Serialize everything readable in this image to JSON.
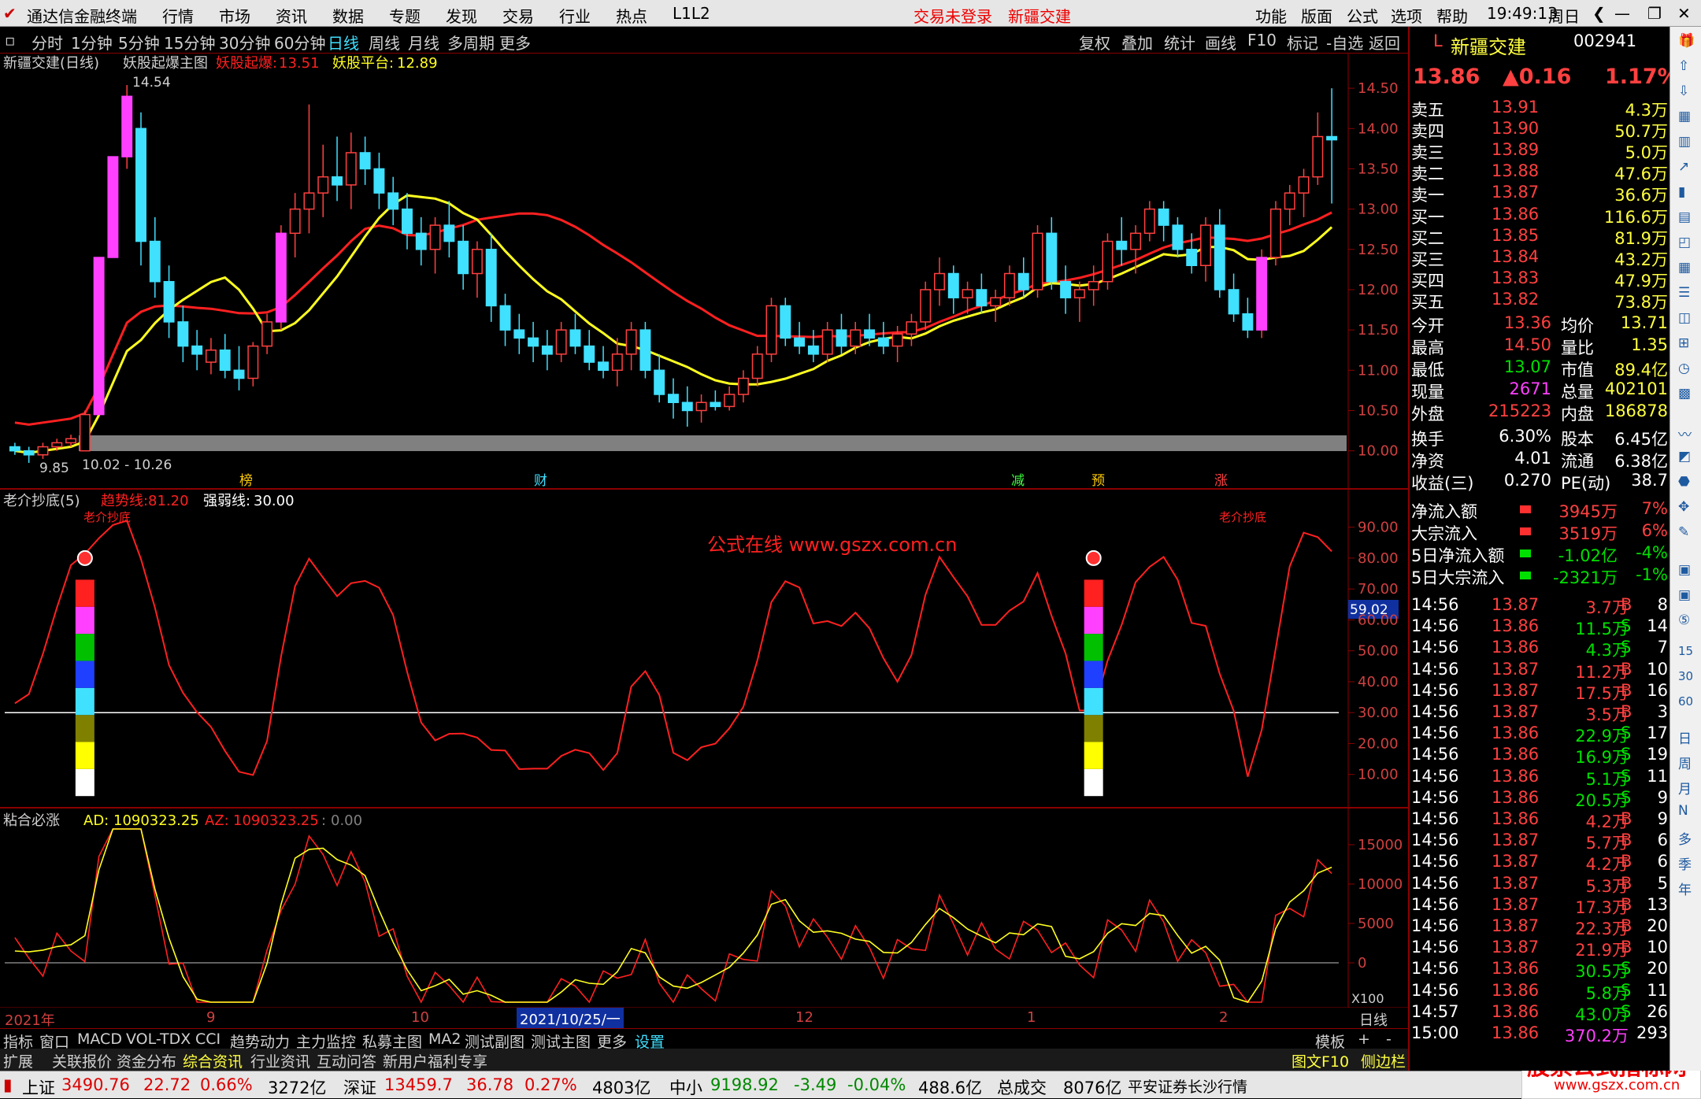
{
  "app": {
    "title": "通达信金融终端",
    "menu": [
      "行情",
      "市场",
      "资讯",
      "数据",
      "专题",
      "发现",
      "交易",
      "行业",
      "热点",
      "L1L2"
    ],
    "login": "交易未登录",
    "stock_name_top": "新疆交建",
    "right_menu": [
      "功能",
      "版面",
      "公式",
      "选项",
      "帮助"
    ],
    "time": "19:49:13",
    "weekday": "周日"
  },
  "periods": [
    "分时",
    "1分钟",
    "5分钟",
    "15分钟",
    "30分钟",
    "60分钟",
    "日线",
    "周线",
    "月线",
    "多周期",
    "更多"
  ],
  "active_period": "日线",
  "tools": [
    "复权",
    "叠加",
    "统计",
    "画线",
    "F10",
    "标记",
    "-自选",
    "返回"
  ],
  "main_panel": {
    "title": "新疆交建(日线)",
    "formula": "妖股起爆主图",
    "label1": "妖股起爆:",
    "val1": "13.51",
    "label2": "妖股平台:",
    "val2": "12.89",
    "yticks": [
      "14.50",
      "14.00",
      "13.50",
      "13.00",
      "12.50",
      "12.00",
      "11.50",
      "11.00",
      "10.50",
      "10.00"
    ],
    "hi_label": "14.54",
    "lo_label": "9.85",
    "range_label": "10.02 - 10.26",
    "markers": [
      "榜",
      "财",
      "减",
      "预",
      "涨"
    ]
  },
  "sub1": {
    "title": "老介抄底(5)",
    "label1": "趋势线:",
    "val1": "81.20",
    "label2": "强弱线:",
    "val2": "30.00",
    "yticks": [
      "90.00",
      "80.00",
      "70.00",
      "60.00",
      "50.00",
      "40.00",
      "30.00",
      "20.00",
      "10.00"
    ],
    "current": "59.02",
    "signal": "老介抄底",
    "watermark": "公式在线  www.gszx.com.cn"
  },
  "sub2": {
    "title": "粘合必涨",
    "label1": "AD:",
    "val1": "1090323.25",
    "label2": "AZ:",
    "val2": "1090323.25",
    "label3": ":",
    "val3": "0.00",
    "yticks": [
      "15000",
      "10000",
      "5000",
      "0"
    ],
    "scale": "X100"
  },
  "xaxis": {
    "labels": [
      "2021年",
      "9",
      "10",
      "2021/10/25/一",
      "12",
      "1",
      "2"
    ],
    "period": "日线"
  },
  "tabs1": [
    "指标",
    "窗口",
    "MACD",
    "VOL-TDX",
    "CCI",
    "趋势动力",
    "主力监控",
    "私募主图",
    "MA2",
    "测试副图",
    "测试主图",
    "更多",
    "设置",
    "模板",
    "+",
    "-"
  ],
  "tabs2": [
    "扩展",
    "关联报价",
    "资金分布",
    "综合资讯",
    "行业资讯",
    "互动问答",
    "新用户福利专享"
  ],
  "tabs2_right": [
    "图文F10",
    "侧边栏",
    "笔",
    "价",
    "细",
    "势"
  ],
  "status": {
    "sh_label": "上证",
    "sh_val": "3490.76",
    "sh_chg": "22.72",
    "sh_pct": "0.66%",
    "sh_amt": "3272亿",
    "sz_label": "深证",
    "sz_val": "13459.7",
    "sz_chg": "36.78",
    "sz_pct": "0.27%",
    "sz_amt": "4803亿",
    "zx_label": "中小",
    "zx_val": "9198.92",
    "zx_chg": "-3.49",
    "zx_pct": "-0.04%",
    "zx_amt": "488.6亿",
    "total_label": "总成交",
    "total_val": "8076亿",
    "broker": "平安证券长沙行情",
    "brand": "股票公式指标网",
    "brand_url": "www.gszx.com.cn"
  },
  "quote": {
    "prefix": "L",
    "name": "新疆交建",
    "code": "002941",
    "price": "13.86",
    "change": "▲0.16",
    "pct": "1.17%",
    "asks": [
      {
        "label": "卖五",
        "price": "13.91",
        "vol": "4.3万"
      },
      {
        "label": "卖四",
        "price": "13.90",
        "vol": "50.7万"
      },
      {
        "label": "卖三",
        "price": "13.89",
        "vol": "5.0万"
      },
      {
        "label": "卖二",
        "price": "13.88",
        "vol": "47.6万"
      },
      {
        "label": "卖一",
        "price": "13.87",
        "vol": "36.6万"
      }
    ],
    "bids": [
      {
        "label": "买一",
        "price": "13.86",
        "vol": "116.6万"
      },
      {
        "label": "买二",
        "price": "13.85",
        "vol": "81.9万"
      },
      {
        "label": "买三",
        "price": "13.84",
        "vol": "43.2万"
      },
      {
        "label": "买四",
        "price": "13.83",
        "vol": "47.9万"
      },
      {
        "label": "买五",
        "price": "13.82",
        "vol": "73.8万"
      }
    ],
    "stats": [
      [
        "今开",
        "13.36",
        "均价",
        "13.71"
      ],
      [
        "最高",
        "14.50",
        "量比",
        "1.35"
      ],
      [
        "最低",
        "13.07",
        "市值",
        "89.4亿"
      ],
      [
        "现量",
        "2671",
        "总量",
        "402101"
      ],
      [
        "外盘",
        "215223",
        "内盘",
        "186878"
      ]
    ],
    "stats2": [
      [
        "换手",
        "6.30%",
        "股本",
        "6.45亿"
      ],
      [
        "净资",
        "4.01",
        "流通",
        "6.38亿"
      ],
      [
        "收益(三)",
        "0.270",
        "PE(动)",
        "38.7"
      ]
    ],
    "flows": [
      [
        "净流入额",
        "3945万",
        "7%"
      ],
      [
        "大宗流入",
        "3519万",
        "6%"
      ],
      [
        "5日净流入额",
        "-1.02亿",
        "-4%"
      ],
      [
        "5日大宗流入",
        "-2321万",
        "-1%"
      ]
    ],
    "ticks": [
      [
        "14:56",
        "13.87",
        "3.7万",
        "B",
        "8"
      ],
      [
        "14:56",
        "13.86",
        "11.5万",
        "S",
        "14"
      ],
      [
        "14:56",
        "13.86",
        "4.3万",
        "S",
        "7"
      ],
      [
        "14:56",
        "13.87",
        "11.2万",
        "B",
        "10"
      ],
      [
        "14:56",
        "13.87",
        "17.5万",
        "B",
        "16"
      ],
      [
        "14:56",
        "13.87",
        "3.5万",
        "B",
        "3"
      ],
      [
        "14:56",
        "13.86",
        "22.9万",
        "S",
        "17"
      ],
      [
        "14:56",
        "13.86",
        "16.9万",
        "S",
        "19"
      ],
      [
        "14:56",
        "13.86",
        "5.1万",
        "S",
        "11"
      ],
      [
        "14:56",
        "13.86",
        "20.5万",
        "S",
        "9"
      ],
      [
        "14:56",
        "13.86",
        "4.2万",
        "B",
        "9"
      ],
      [
        "14:56",
        "13.87",
        "5.7万",
        "B",
        "6"
      ],
      [
        "14:56",
        "13.87",
        "4.2万",
        "B",
        "6"
      ],
      [
        "14:56",
        "13.87",
        "5.3万",
        "B",
        "5"
      ],
      [
        "14:56",
        "13.87",
        "17.3万",
        "B",
        "13"
      ],
      [
        "14:56",
        "13.87",
        "22.3万",
        "B",
        "20"
      ],
      [
        "14:56",
        "13.87",
        "21.9万",
        "B",
        "10"
      ],
      [
        "14:56",
        "13.86",
        "30.5万",
        "S",
        "20"
      ],
      [
        "14:56",
        "13.86",
        "5.8万",
        "S",
        "11"
      ],
      [
        "14:57",
        "13.86",
        "43.0万",
        "S",
        "26"
      ],
      [
        "15:00",
        "13.86",
        "370.2万",
        "",
        "293"
      ]
    ]
  },
  "sidebar": [
    "日",
    "周",
    "月",
    "N",
    "多",
    "季",
    "年"
  ],
  "colors": {
    "up": "#ff40ff",
    "down": "#40e0ff",
    "ma_red": "#ff2020",
    "ma_yellow": "#ffff20",
    "trend": "#ff2020"
  },
  "chart_data": [
    {
      "type": "candlestick",
      "title": "新疆交建(日线)",
      "ylim": [
        9.85,
        14.54
      ],
      "ohlc": [
        [
          10.05,
          10.1,
          9.95,
          10.0
        ],
        [
          10.0,
          10.05,
          9.85,
          9.95
        ],
        [
          9.95,
          10.1,
          9.9,
          10.05
        ],
        [
          10.05,
          10.15,
          10.0,
          10.1
        ],
        [
          10.1,
          10.2,
          10.05,
          10.15
        ],
        [
          10.0,
          10.5,
          10.0,
          10.45
        ],
        [
          10.45,
          12.4,
          10.45,
          12.4
        ],
        [
          12.4,
          13.65,
          12.4,
          13.65
        ],
        [
          13.65,
          14.54,
          13.5,
          14.4
        ],
        [
          14.0,
          14.2,
          12.3,
          12.6
        ],
        [
          12.6,
          12.9,
          11.9,
          12.1
        ],
        [
          12.1,
          12.3,
          11.4,
          11.6
        ],
        [
          11.6,
          11.8,
          11.1,
          11.3
        ],
        [
          11.3,
          11.5,
          11.0,
          11.2
        ],
        [
          11.1,
          11.4,
          10.95,
          11.25
        ],
        [
          11.25,
          11.45,
          10.9,
          11.0
        ],
        [
          11.0,
          11.3,
          10.75,
          10.9
        ],
        [
          10.9,
          11.35,
          10.8,
          11.3
        ],
        [
          11.3,
          11.7,
          11.2,
          11.6
        ],
        [
          11.6,
          12.8,
          11.5,
          12.7
        ],
        [
          12.7,
          13.2,
          12.4,
          13.0
        ],
        [
          13.0,
          14.3,
          12.7,
          13.2
        ],
        [
          13.2,
          13.8,
          12.9,
          13.4
        ],
        [
          13.4,
          13.9,
          13.1,
          13.3
        ],
        [
          13.3,
          13.95,
          13.0,
          13.7
        ],
        [
          13.7,
          13.9,
          13.3,
          13.5
        ],
        [
          13.5,
          13.7,
          13.0,
          13.2
        ],
        [
          13.2,
          13.4,
          12.8,
          13.0
        ],
        [
          13.0,
          13.2,
          12.5,
          12.7
        ],
        [
          12.7,
          12.9,
          12.3,
          12.5
        ],
        [
          12.5,
          12.9,
          12.2,
          12.8
        ],
        [
          12.8,
          13.1,
          12.4,
          12.6
        ],
        [
          12.6,
          12.8,
          12.0,
          12.2
        ],
        [
          12.2,
          12.6,
          11.9,
          12.5
        ],
        [
          12.5,
          12.7,
          11.6,
          11.8
        ],
        [
          11.8,
          11.95,
          11.3,
          11.5
        ],
        [
          11.5,
          11.7,
          11.2,
          11.4
        ],
        [
          11.4,
          11.6,
          11.1,
          11.3
        ],
        [
          11.3,
          11.5,
          11.0,
          11.2
        ],
        [
          11.2,
          11.6,
          11.1,
          11.5
        ],
        [
          11.5,
          11.7,
          11.2,
          11.3
        ],
        [
          11.3,
          11.5,
          11.0,
          11.1
        ],
        [
          11.1,
          11.3,
          10.9,
          11.0
        ],
        [
          11.0,
          11.4,
          10.8,
          11.2
        ],
        [
          11.2,
          11.6,
          11.0,
          11.5
        ],
        [
          11.5,
          11.6,
          10.9,
          11.0
        ],
        [
          11.0,
          11.2,
          10.6,
          10.7
        ],
        [
          10.7,
          10.9,
          10.4,
          10.6
        ],
        [
          10.6,
          10.8,
          10.3,
          10.5
        ],
        [
          10.5,
          10.7,
          10.35,
          10.6
        ],
        [
          10.6,
          10.75,
          10.5,
          10.55
        ],
        [
          10.55,
          10.8,
          10.5,
          10.7
        ],
        [
          10.7,
          11.0,
          10.6,
          10.9
        ],
        [
          10.9,
          11.3,
          10.8,
          11.2
        ],
        [
          11.2,
          11.9,
          11.1,
          11.8
        ],
        [
          11.8,
          11.9,
          11.3,
          11.4
        ],
        [
          11.4,
          11.6,
          11.2,
          11.3
        ],
        [
          11.3,
          11.5,
          11.1,
          11.2
        ],
        [
          11.2,
          11.6,
          11.1,
          11.5
        ],
        [
          11.5,
          11.7,
          11.2,
          11.3
        ],
        [
          11.3,
          11.6,
          11.2,
          11.5
        ],
        [
          11.5,
          11.7,
          11.3,
          11.4
        ],
        [
          11.4,
          11.6,
          11.2,
          11.3
        ],
        [
          11.3,
          11.55,
          11.1,
          11.45
        ],
        [
          11.45,
          11.7,
          11.3,
          11.6
        ],
        [
          11.6,
          12.1,
          11.5,
          12.0
        ],
        [
          12.0,
          12.4,
          11.8,
          12.2
        ],
        [
          12.2,
          12.3,
          11.7,
          11.9
        ],
        [
          11.9,
          12.1,
          11.7,
          12.0
        ],
        [
          12.0,
          12.2,
          11.7,
          11.8
        ],
        [
          11.8,
          12.0,
          11.6,
          11.9
        ],
        [
          11.9,
          12.3,
          11.8,
          12.2
        ],
        [
          12.2,
          12.4,
          11.9,
          12.0
        ],
        [
          12.0,
          12.8,
          11.9,
          12.7
        ],
        [
          12.7,
          12.9,
          12.0,
          12.1
        ],
        [
          12.1,
          12.3,
          11.7,
          11.9
        ],
        [
          11.9,
          12.1,
          11.6,
          12.0
        ],
        [
          12.0,
          12.3,
          11.8,
          12.1
        ],
        [
          12.1,
          12.7,
          12.0,
          12.6
        ],
        [
          12.6,
          12.9,
          12.3,
          12.5
        ],
        [
          12.5,
          12.8,
          12.2,
          12.7
        ],
        [
          12.7,
          13.1,
          12.6,
          13.0
        ],
        [
          13.0,
          13.1,
          12.6,
          12.8
        ],
        [
          12.8,
          12.9,
          12.4,
          12.5
        ],
        [
          12.5,
          12.7,
          12.2,
          12.3
        ],
        [
          12.3,
          12.9,
          12.1,
          12.8
        ],
        [
          12.8,
          13.0,
          11.9,
          12.0
        ],
        [
          12.0,
          12.2,
          11.6,
          11.7
        ],
        [
          11.7,
          11.9,
          11.4,
          11.5
        ],
        [
          11.5,
          12.5,
          11.4,
          12.4
        ],
        [
          12.4,
          13.1,
          12.3,
          13.0
        ],
        [
          13.0,
          13.3,
          12.8,
          13.2
        ],
        [
          13.2,
          13.5,
          12.9,
          13.4
        ],
        [
          13.4,
          14.2,
          13.3,
          13.9
        ],
        [
          13.9,
          14.5,
          13.07,
          13.86
        ]
      ]
    },
    {
      "type": "line",
      "title": "老介抄底(5)",
      "series": [
        {
          "name": "趋势线"
        },
        {
          "name": "强弱线"
        }
      ],
      "ylim": [
        0,
        95
      ]
    },
    {
      "type": "line",
      "title": "粘合必涨",
      "series": [
        {
          "name": "AD"
        },
        {
          "name": "AZ"
        }
      ],
      "ylim": [
        -5000,
        17000
      ]
    }
  ]
}
